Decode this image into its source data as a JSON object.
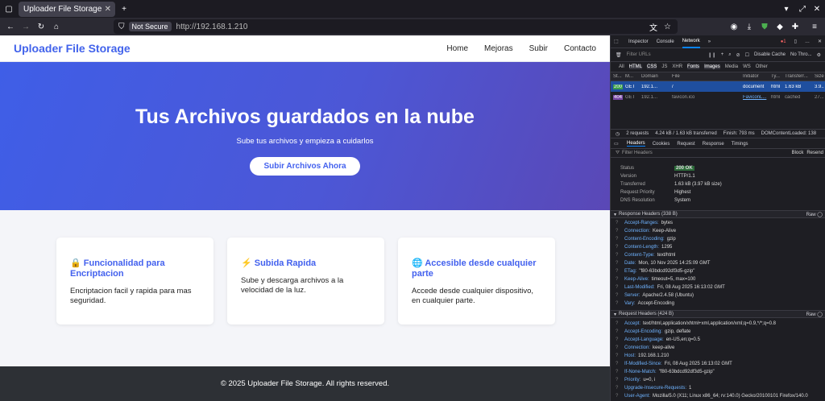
{
  "browser": {
    "tab_title": "Uploader File Storage",
    "url_security": "Not Secure",
    "url": "http://192.168.1.210"
  },
  "site": {
    "brand": "Uploader File Storage",
    "nav": [
      "Home",
      "Mejoras",
      "Subir",
      "Contacto"
    ],
    "hero_title": "Tus Archivos guardados en la nube",
    "hero_subtitle": "Sube tus archivos y empieza a cuidarlos",
    "cta": "Subir Archivos Ahora",
    "cards": [
      {
        "title": "🔒 Funcionalidad para Encriptacion",
        "text": "Encriptacion facil y rapida para mas seguridad."
      },
      {
        "title": "⚡ Subida Rapida",
        "text": "Sube y descarga archivos a la velocidad de la luz."
      },
      {
        "title": "🌐 Accesible desde cualquier parte",
        "text": "Accede desde cualquier dispositivo, en cualquier parte."
      }
    ],
    "footer": "© 2025 Uploader File Storage. All rights reserved."
  },
  "devtools": {
    "tabs": [
      "Inspector",
      "Console",
      "Network"
    ],
    "filter_placeholder": "Filter URLs",
    "disable_cache": "Disable Cache",
    "throttle": "No Thro...",
    "type_filters": [
      "All",
      "HTML",
      "CSS",
      "JS",
      "XHR",
      "Fonts",
      "Images",
      "Media",
      "WS",
      "Other"
    ],
    "columns": [
      "St...",
      "M...",
      "Domain",
      "File",
      "Initiator",
      "Ty...",
      "Transferr...",
      "Size"
    ],
    "rows": [
      [
        "200",
        "GET",
        "192.1...",
        "/",
        "document",
        "html",
        "1.63 kB",
        "3.9..."
      ],
      [
        "404",
        "GET",
        "192.1...",
        "favicon.ico",
        "FaviconL...",
        "html",
        "cached",
        "27..."
      ]
    ],
    "summary": [
      "2 requests",
      "4.24 kB / 1.63 kB transferred",
      "Finish: 793 ms",
      "DOMContentLoaded: 138"
    ],
    "detail_tabs": [
      "Headers",
      "Cookies",
      "Request",
      "Response",
      "Timings"
    ],
    "filter_headers": "Filter Headers",
    "block": "Block",
    "resend": "Resend",
    "status_rows": [
      [
        "Status",
        "200 OK"
      ],
      [
        "Version",
        "HTTP/1.1"
      ],
      [
        "Transferred",
        "1.63 kB (3.97 kB size)"
      ],
      [
        "Request Priority",
        "Highest"
      ],
      [
        "DNS Resolution",
        "System"
      ]
    ],
    "response_headers_title": "Response Headers (338 B)",
    "raw": "Raw",
    "response_headers": [
      [
        "Accept-Ranges:",
        "bytes"
      ],
      [
        "Connection:",
        "Keep-Alive"
      ],
      [
        "Content-Encoding:",
        "gzip"
      ],
      [
        "Content-Length:",
        "1295"
      ],
      [
        "Content-Type:",
        "text/html"
      ],
      [
        "Date:",
        "Mon, 10 Nov 2025 14:25:09 GMT"
      ],
      [
        "ETag:",
        "\"f80-63bdcd92df3d5-gzip\""
      ],
      [
        "Keep-Alive:",
        "timeout=5, max=100"
      ],
      [
        "Last-Modified:",
        "Fri, 08 Aug 2025 16:13:02 GMT"
      ],
      [
        "Server:",
        "Apache/2.4.58 (Ubuntu)"
      ],
      [
        "Vary:",
        "Accept-Encoding"
      ]
    ],
    "request_headers_title": "Request Headers (424 B)",
    "request_headers": [
      [
        "Accept:",
        "text/html,application/xhtml+xml,application/xml;q=0.9,*/*;q=0.8"
      ],
      [
        "Accept-Encoding:",
        "gzip, deflate"
      ],
      [
        "Accept-Language:",
        "en-US,en;q=0.5"
      ],
      [
        "Connection:",
        "keep-alive"
      ],
      [
        "Host:",
        "192.168.1.210"
      ],
      [
        "If-Modified-Since:",
        "Fri, 08 Aug 2025 16:13:02 GMT"
      ],
      [
        "If-None-Match:",
        "\"f80-63bdcd92df3d5-gzip\""
      ],
      [
        "Priority:",
        "u=0, i"
      ],
      [
        "Upgrade-Insecure-Requests:",
        "1"
      ],
      [
        "User-Agent:",
        "Mozilla/5.0 (X11; Linux x86_64; rv:140.0) Gecko/20100101 Firefox/140.0"
      ]
    ]
  }
}
